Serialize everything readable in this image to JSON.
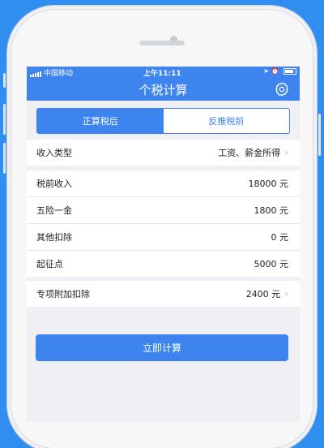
{
  "status_bar": {
    "carrier": "中国移动",
    "time": "上午11:11"
  },
  "header": {
    "title": "个税计算"
  },
  "segment": {
    "tab1": "正算税后",
    "tab2": "反推税前"
  },
  "income_type": {
    "label": "收入类型",
    "value": "工资、薪金所得"
  },
  "fields": [
    {
      "label": "税前收入",
      "value": "18000 元"
    },
    {
      "label": "五险一金",
      "value": "1800 元"
    },
    {
      "label": "其他扣除",
      "value": "0 元"
    },
    {
      "label": "起征点",
      "value": "5000 元"
    }
  ],
  "special": {
    "label": "专项附加扣除",
    "value": "2400 元"
  },
  "action": {
    "label": "立即计算"
  },
  "colors": {
    "accent": "#3d84ef",
    "background": "#2f8ef0"
  }
}
